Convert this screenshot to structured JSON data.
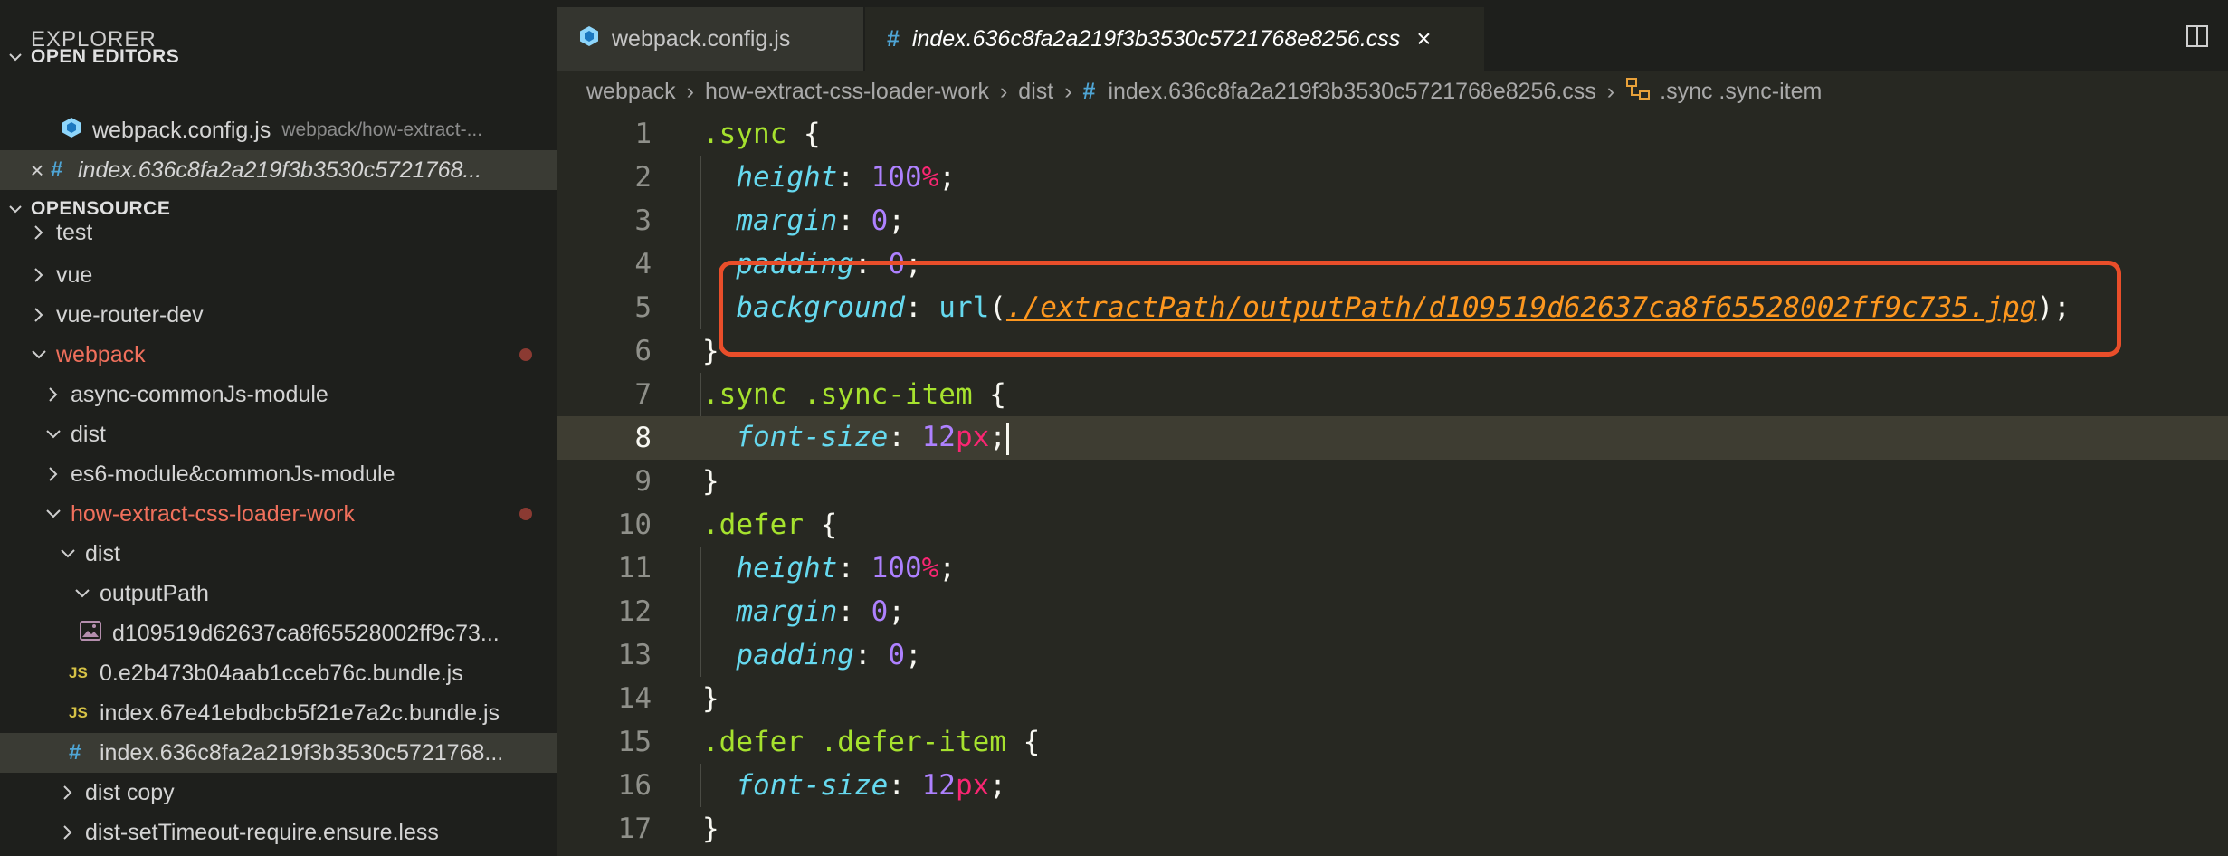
{
  "sidebar": {
    "title": "EXPLORER",
    "open_editors": {
      "header": "OPEN EDITORS",
      "items": [
        {
          "name": "webpack.config.js",
          "path": "webpack/how-extract-..."
        },
        {
          "name": "index.636c8fa2a219f3b3530c5721768..."
        }
      ]
    },
    "opensource": {
      "header": "OPENSOURCE",
      "items": [
        {
          "label": "test"
        },
        {
          "label": "vue"
        },
        {
          "label": "vue-router-dev"
        },
        {
          "label": "webpack"
        },
        {
          "label": "async-commonJs-module"
        },
        {
          "label": "dist"
        },
        {
          "label": "es6-module&commonJs-module"
        },
        {
          "label": "how-extract-css-loader-work"
        },
        {
          "label": "dist"
        },
        {
          "label": "outputPath"
        },
        {
          "label": "d109519d62637ca8f65528002ff9c73..."
        },
        {
          "label": "0.e2b473b04aab1cceb76c.bundle.js"
        },
        {
          "label": "index.67e41ebdbcb5f21e7a2c.bundle.js"
        },
        {
          "label": "index.636c8fa2a219f3b3530c5721768..."
        },
        {
          "label": "dist copy"
        },
        {
          "label": "dist-setTimeout-require.ensure.less"
        }
      ]
    }
  },
  "tabs": [
    {
      "label": "webpack.config.js",
      "active": false
    },
    {
      "label": "index.636c8fa2a219f3b3530c5721768e8256.css",
      "active": true
    }
  ],
  "breadcrumb": {
    "parts": [
      "webpack",
      "how-extract-css-loader-work",
      "dist"
    ],
    "file": "index.636c8fa2a219f3b3530c5721768e8256.css",
    "symbol": ".sync .sync-item"
  },
  "editor": {
    "line_numbers": [
      "1",
      "2",
      "3",
      "4",
      "5",
      "6",
      "7",
      "8",
      "9",
      "10",
      "11",
      "12",
      "13",
      "14",
      "15",
      "16",
      "17"
    ],
    "current_line": 8,
    "tokens": {
      "sync": ".sync",
      "sync_item": ".sync .sync-item",
      "defer": ".defer",
      "defer_item": ".defer .defer-item",
      "height": "height",
      "margin": "margin",
      "padding": "padding",
      "background": "background",
      "font_size": "font-size",
      "v100": "100",
      "v0": "0",
      "v12": "12",
      "pct": "%",
      "px": "px",
      "url_fn": "url",
      "url_path": "./extractPath/outputPath/d109519d62637ca8f65528002ff9c735.jpg"
    }
  },
  "colors": {
    "highlight_box": "#e94e2a",
    "selector": "#a6e22e",
    "property": "#66d9ef",
    "number": "#ae81ff",
    "unit": "#f92672"
  }
}
